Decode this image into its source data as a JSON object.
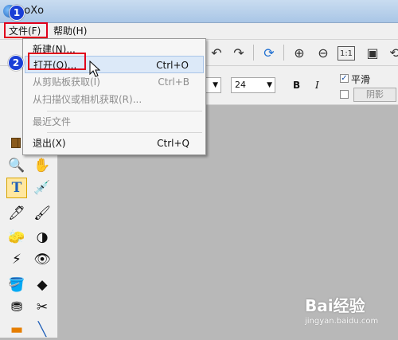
{
  "window": {
    "title": "hoXo"
  },
  "menubar": {
    "file": "文件(F)",
    "help": "帮助(H)"
  },
  "steps": {
    "one": "1",
    "two": "2"
  },
  "format": {
    "font_size": "24",
    "bold": "B",
    "italic": "I",
    "smooth_checked": "✓",
    "smooth_label": "平滑",
    "shadow_label": "阴影"
  },
  "file_menu": {
    "items": [
      {
        "label": "新建(N)...",
        "shortcut": "",
        "disabled": false
      },
      {
        "label": "打开(O)...",
        "shortcut": "Ctrl+O",
        "disabled": false
      },
      {
        "label": "从剪贴板获取(I)",
        "shortcut": "Ctrl+B",
        "disabled": true
      },
      {
        "label": "从扫描仪或相机获取(R)...",
        "shortcut": "",
        "disabled": true
      },
      {
        "label": "最近文件",
        "shortcut": "",
        "disabled": true
      },
      {
        "label": "退出(X)",
        "shortcut": "Ctrl+Q",
        "disabled": false
      }
    ]
  },
  "toolbar": {
    "zoom_actual": "1:1"
  },
  "watermark": {
    "brand": "Bai经验",
    "site": "jingyan.baidu.com"
  }
}
